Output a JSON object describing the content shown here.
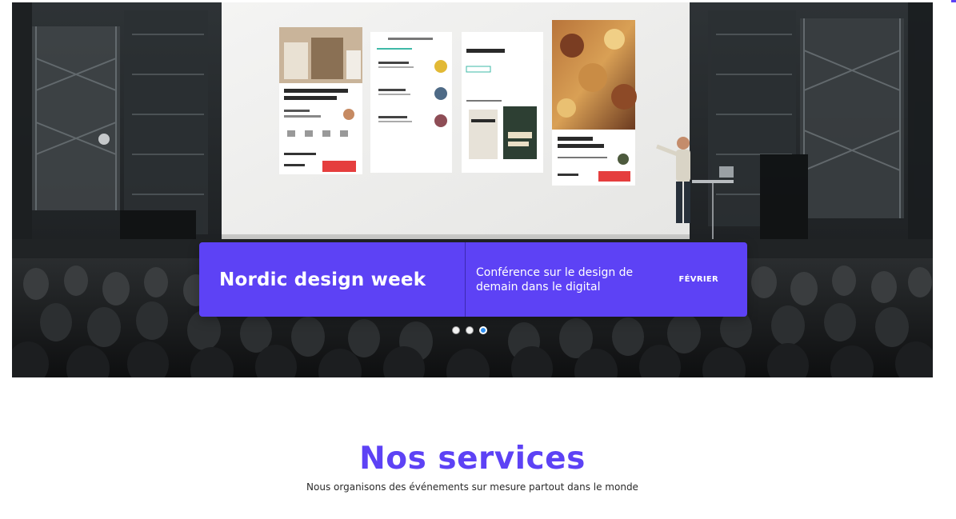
{
  "hero": {
    "slide": {
      "title": "Nordic design week",
      "description": "Conférence sur le design de demain dans le digital",
      "month": "FÉVRIER"
    },
    "carousel": {
      "total_slides": 3,
      "active_index": 3
    },
    "screen_mockups": {
      "card1": {
        "title": "Loft with Open Floor Plan and Kitchen",
        "meta": "Entire home",
        "host": "Hosted by Cassie",
        "about": "About this home",
        "price": "$150",
        "cta": "Book"
      },
      "card2": {
        "header": "Choose a reservation",
        "tab_left": "Upcoming",
        "tab_right": "Previous",
        "rows": [
          "Angela Anderson",
          "Mandeep Mittal",
          "Amanda Bourke"
        ]
      },
      "card3": {
        "city": "Los Angeles",
        "book1": "ZEN EXPLORERS",
        "book2": "LAW CHEF"
      },
      "card4": {
        "title": "Pop-up Restaurant Tour",
        "cta": "Book now"
      }
    }
  },
  "services": {
    "title": "Nos services",
    "subtitle": "Nous organisons des événements sur mesure partout dans le monde"
  },
  "colors": {
    "accent": "#5d42f5",
    "book_button": "#e53e3e"
  }
}
